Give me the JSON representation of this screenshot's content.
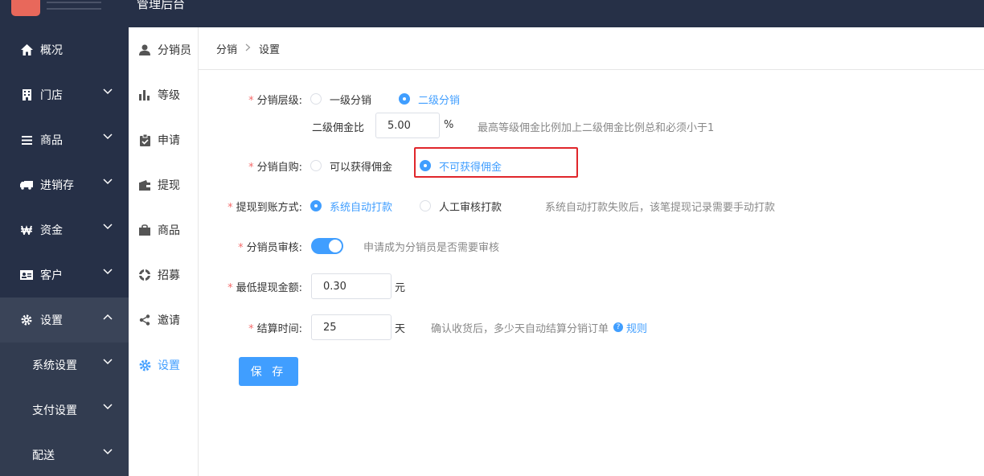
{
  "header": {
    "title": "管理后台"
  },
  "sidebar": {
    "items": [
      {
        "label": "概况",
        "icon": "home-icon",
        "has_children": false
      },
      {
        "label": "门店",
        "icon": "building-icon",
        "has_children": true
      },
      {
        "label": "商品",
        "icon": "list-icon",
        "has_children": true
      },
      {
        "label": "进销存",
        "icon": "truck-icon",
        "has_children": true
      },
      {
        "label": "资金",
        "icon": "won-icon",
        "has_children": true
      },
      {
        "label": "客户",
        "icon": "id-card-icon",
        "has_children": true
      },
      {
        "label": "设置",
        "icon": "gear-icon",
        "has_children": true,
        "expanded": true
      }
    ],
    "sub_items": [
      {
        "label": "系统设置"
      },
      {
        "label": "支付设置"
      },
      {
        "label": "配送"
      }
    ]
  },
  "subsidebar": {
    "items": [
      {
        "label": "分销员",
        "icon": "user-icon"
      },
      {
        "label": "等级",
        "icon": "bar-chart-icon"
      },
      {
        "label": "申请",
        "icon": "clipboard-icon"
      },
      {
        "label": "提现",
        "icon": "wallet-icon"
      },
      {
        "label": "商品",
        "icon": "bag-icon"
      },
      {
        "label": "招募",
        "icon": "recruit-icon"
      },
      {
        "label": "邀请",
        "icon": "share-icon"
      },
      {
        "label": "设置",
        "icon": "gear-icon",
        "active": true
      }
    ]
  },
  "breadcrumb": {
    "parent": "分销",
    "current": "设置"
  },
  "form": {
    "level": {
      "label": "分销层级:",
      "options": [
        "一级分销",
        "二级分销"
      ],
      "selected": "二级分销"
    },
    "commission": {
      "label": "二级佣金比",
      "value": "5.00",
      "unit": "%",
      "hint": "最高等级佣金比例加上二级佣金比例总和必须小于1"
    },
    "self_purchase": {
      "label": "分销自购:",
      "options": [
        "可以获得佣金",
        "不可获得佣金"
      ],
      "selected": "不可获得佣金"
    },
    "withdraw": {
      "label": "提现到账方式:",
      "options": [
        "系统自动打款",
        "人工审核打款"
      ],
      "selected": "系统自动打款",
      "hint": "系统自动打款失败后，该笔提现记录需要手动打款"
    },
    "review": {
      "label": "分销员审核:",
      "enabled": true,
      "hint": "申请成为分销员是否需要审核"
    },
    "min_withdraw": {
      "label": "最低提现金额:",
      "value": "0.30",
      "unit": "元"
    },
    "settle": {
      "label": "结算时间:",
      "value": "25",
      "unit": "天",
      "hint": "确认收货后，多少天自动结算分销订单",
      "link": "规则"
    },
    "save_label": "保 存"
  },
  "colors": {
    "primary": "#409eff",
    "sidebar_bg": "#263047",
    "highlight": "#e0262b",
    "required": "#f56c6c"
  }
}
